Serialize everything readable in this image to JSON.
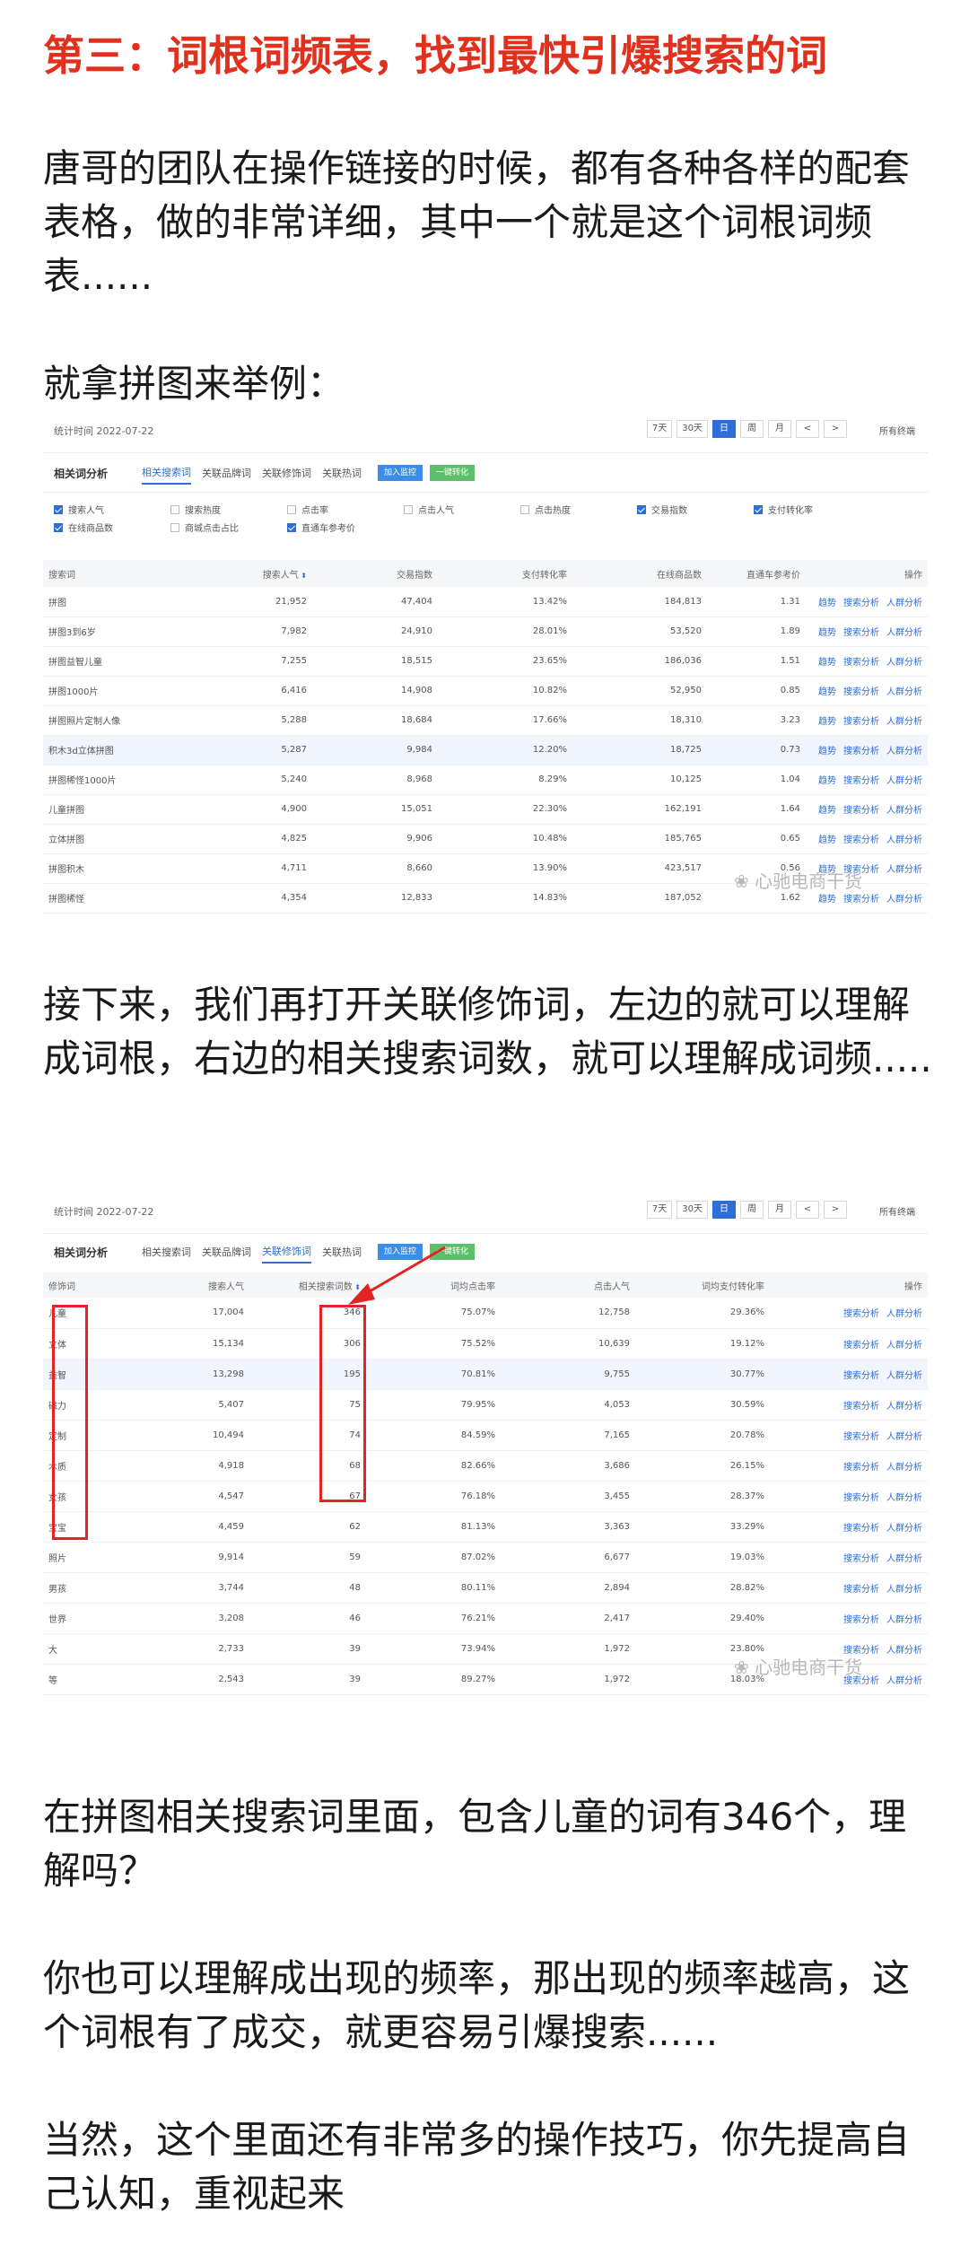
{
  "article": {
    "heading": "第三：词根词频表，找到最快引爆搜索的词",
    "p1": "唐哥的团队在操作链接的时候，都有各种各样的配套表格，做的非常详细，其中一个就是这个词根词频表......",
    "p2": "就拿拼图来举例：",
    "p3": "接下来，我们再打开关联修饰词，左边的就可以理解成词根，右边的相关搜索词数，就可以理解成词频.....",
    "p4": "在拼图相关搜索词里面，包含儿童的词有346个，理解吗？",
    "p5": "你也可以理解成出现的频率，那出现的频率越高，这个词根有了成交，就更容易引爆搜索......",
    "p6": "当然，这个里面还有非常多的操作技巧，你先提高自己认知，重视起来"
  },
  "shot1": {
    "stat_time": "统计时间 2022-07-22",
    "date_buttons": [
      "7天",
      "30天",
      "日",
      "周",
      "月",
      "<",
      ">"
    ],
    "active_date": "日",
    "industry": "所有终端",
    "section_title": "相关词分析",
    "tabs": [
      "相关搜索词",
      "关联品牌词",
      "关联修饰词",
      "关联热词"
    ],
    "active_tab": "相关搜索词",
    "btn_blue": "加入监控",
    "btn_green": "一键转化",
    "options": [
      {
        "label": "搜索人气",
        "checked": true
      },
      {
        "label": "搜索热度",
        "checked": false
      },
      {
        "label": "点击率",
        "checked": false
      },
      {
        "label": "点击人气",
        "checked": false
      },
      {
        "label": "点击热度",
        "checked": false
      },
      {
        "label": "交易指数",
        "checked": true
      },
      {
        "label": "支付转化率",
        "checked": true
      },
      {
        "label": "在线商品数",
        "checked": true
      },
      {
        "label": "商城点击占比",
        "checked": false
      },
      {
        "label": "直通车参考价",
        "checked": true
      }
    ],
    "columns": [
      "搜索词",
      "搜索人气",
      "交易指数",
      "支付转化率",
      "在线商品数",
      "直通车参考价",
      "操作"
    ],
    "ops": [
      "趋势",
      "搜索分析",
      "人群分析"
    ],
    "rows": [
      [
        "拼图",
        "21,952",
        "47,404",
        "13.42%",
        "184,813",
        "1.31"
      ],
      [
        "拼图3到6岁",
        "7,982",
        "24,910",
        "28.01%",
        "53,520",
        "1.89"
      ],
      [
        "拼图益智儿童",
        "7,255",
        "18,515",
        "23.65%",
        "186,036",
        "1.51"
      ],
      [
        "拼图1000片",
        "6,416",
        "14,908",
        "10.82%",
        "52,950",
        "0.85"
      ],
      [
        "拼图照片定制人像",
        "5,288",
        "18,684",
        "17.66%",
        "18,310",
        "3.23"
      ],
      [
        "积木3d立体拼图",
        "5,287",
        "9,984",
        "12.20%",
        "18,725",
        "0.73"
      ],
      [
        "拼图稀怪1000片",
        "5,240",
        "8,968",
        "8.29%",
        "10,125",
        "1.04"
      ],
      [
        "儿童拼图",
        "4,900",
        "15,051",
        "22.30%",
        "162,191",
        "1.64"
      ],
      [
        "立体拼图",
        "4,825",
        "9,906",
        "10.48%",
        "185,765",
        "0.65"
      ],
      [
        "拼图积木",
        "4,711",
        "8,660",
        "13.90%",
        "423,517",
        "0.56"
      ],
      [
        "拼图稀怪",
        "4,354",
        "12,833",
        "14.83%",
        "187,052",
        "1.62"
      ]
    ],
    "watermark": "心驰电商干货"
  },
  "shot2": {
    "stat_time": "统计时间 2022-07-22",
    "date_buttons": [
      "7天",
      "30天",
      "日",
      "周",
      "月",
      "<",
      ">"
    ],
    "active_date": "日",
    "industry": "所有终端",
    "section_title": "相关词分析",
    "tabs": [
      "相关搜索词",
      "关联品牌词",
      "关联修饰词",
      "关联热词"
    ],
    "active_tab": "关联修饰词",
    "btn_blue": "加入监控",
    "btn_green": "一键转化",
    "columns": [
      "修饰词",
      "搜索人气",
      "相关搜索词数",
      "词均点击率",
      "点击人气",
      "词均支付转化率",
      "操作"
    ],
    "ops": [
      "搜索分析",
      "人群分析"
    ],
    "rows": [
      [
        "儿童",
        "17,004",
        "346",
        "75.07%",
        "12,758",
        "29.36%"
      ],
      [
        "立体",
        "15,134",
        "306",
        "75.52%",
        "10,639",
        "19.12%"
      ],
      [
        "益智",
        "13,298",
        "195",
        "70.81%",
        "9,755",
        "30.77%"
      ],
      [
        "磁力",
        "5,407",
        "75",
        "79.95%",
        "4,053",
        "30.59%"
      ],
      [
        "定制",
        "10,494",
        "74",
        "84.59%",
        "7,165",
        "20.78%"
      ],
      [
        "木质",
        "4,918",
        "68",
        "82.66%",
        "3,686",
        "26.15%"
      ],
      [
        "女孩",
        "4,547",
        "67",
        "76.18%",
        "3,455",
        "28.37%"
      ],
      [
        "宝宝",
        "4,459",
        "62",
        "81.13%",
        "3,363",
        "33.29%"
      ],
      [
        "照片",
        "9,914",
        "59",
        "87.02%",
        "6,677",
        "19.03%"
      ],
      [
        "男孩",
        "3,744",
        "48",
        "80.11%",
        "2,894",
        "28.82%"
      ],
      [
        "世界",
        "3,208",
        "46",
        "76.21%",
        "2,417",
        "29.40%"
      ],
      [
        "大",
        "2,733",
        "39",
        "73.94%",
        "1,972",
        "23.80%"
      ],
      [
        "等",
        "2,543",
        "39",
        "89.27%",
        "1,972",
        "18.03%"
      ]
    ],
    "watermark": "心驰电商干货"
  },
  "colors": {
    "heading": "#e0301e",
    "accent": "#2d6fd6",
    "annotation": "#e42424"
  }
}
